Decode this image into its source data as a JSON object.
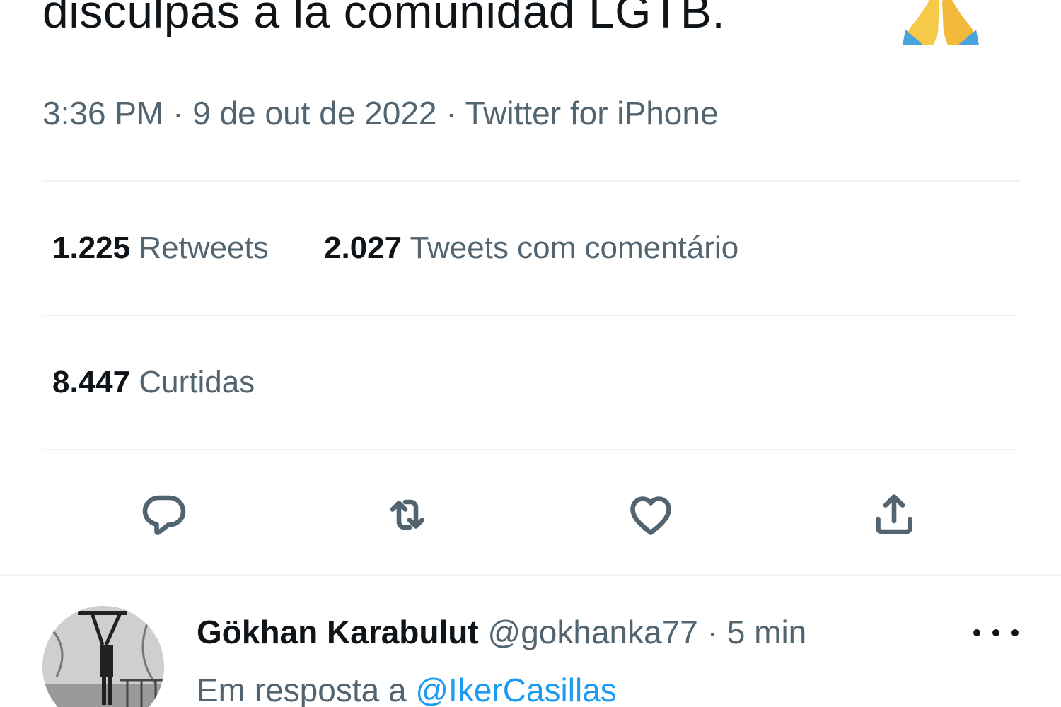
{
  "tweet": {
    "text": "disculpas a la comunidad LGTB.",
    "emoji_icon": "folded-hands-icon",
    "time": "3:36 PM",
    "separator": "·",
    "date": "9 de out de 2022",
    "source": "Twitter for iPhone"
  },
  "stats": {
    "retweets_count": "1.225",
    "retweets_label": "Retweets",
    "quotes_count": "2.027",
    "quotes_label": "Tweets com comentário",
    "likes_count": "8.447",
    "likes_label": "Curtidas"
  },
  "actions": [
    {
      "icon": "reply-icon"
    },
    {
      "icon": "retweet-icon"
    },
    {
      "icon": "heart-icon"
    },
    {
      "icon": "share-icon"
    }
  ],
  "reply": {
    "name": "Gökhan Karabulut",
    "handle": "@gokhanka77",
    "separator": "·",
    "time": "5 min",
    "reply_prefix": "Em resposta a",
    "reply_mention": "@IkerCasillas",
    "more_icon": "more-horizontal-icon"
  },
  "colors": {
    "text_primary": "#0f1419",
    "text_secondary": "#536471",
    "accent": "#1d9bf0",
    "divider": "#eff3f4"
  }
}
